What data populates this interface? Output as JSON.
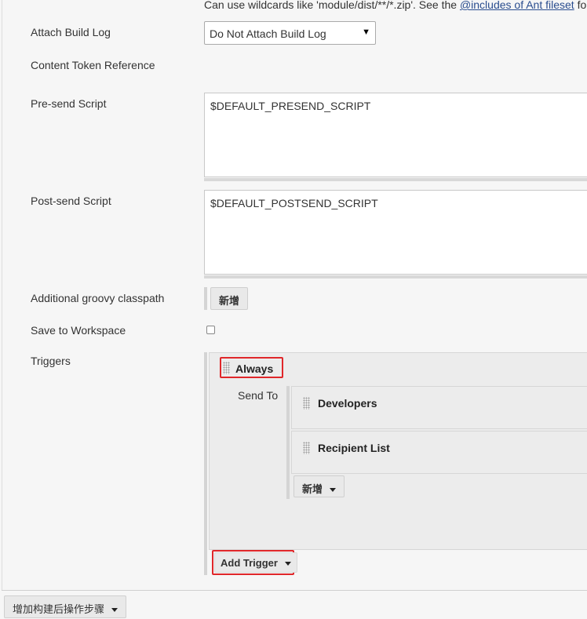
{
  "files_hint": {
    "prefix": "Can use wildcards like 'module/dist/**/*.zip'. See the ",
    "link": "@includes of Ant fileset",
    "suffix": " fo"
  },
  "attach_build_log": {
    "label": "Attach Build Log",
    "selected": "Do Not Attach Build Log"
  },
  "content_token_reference": {
    "label": "Content Token Reference"
  },
  "presend_script": {
    "label": "Pre-send Script",
    "value": "$DEFAULT_PRESEND_SCRIPT"
  },
  "postsend_script": {
    "label": "Post-send Script",
    "value": "$DEFAULT_POSTSEND_SCRIPT"
  },
  "groovy_classpath": {
    "label": "Additional groovy classpath",
    "add_button": "新增"
  },
  "save_to_workspace": {
    "label": "Save to Workspace",
    "checked": false
  },
  "triggers": {
    "label": "Triggers",
    "trigger_name": "Always",
    "send_to_label": "Send To",
    "recipients": [
      "Developers",
      "Recipient List"
    ],
    "add_recipient_button": "新增",
    "add_trigger_button": "Add Trigger"
  },
  "footer": {
    "add_post_build_step_button": "增加构建后操作步骤"
  },
  "colors": {
    "highlight": "#e0272a",
    "link": "#2a4d8f"
  },
  "icons": [
    "drag-handle-icon",
    "caret-down-icon",
    "select-arrow-icon"
  ]
}
